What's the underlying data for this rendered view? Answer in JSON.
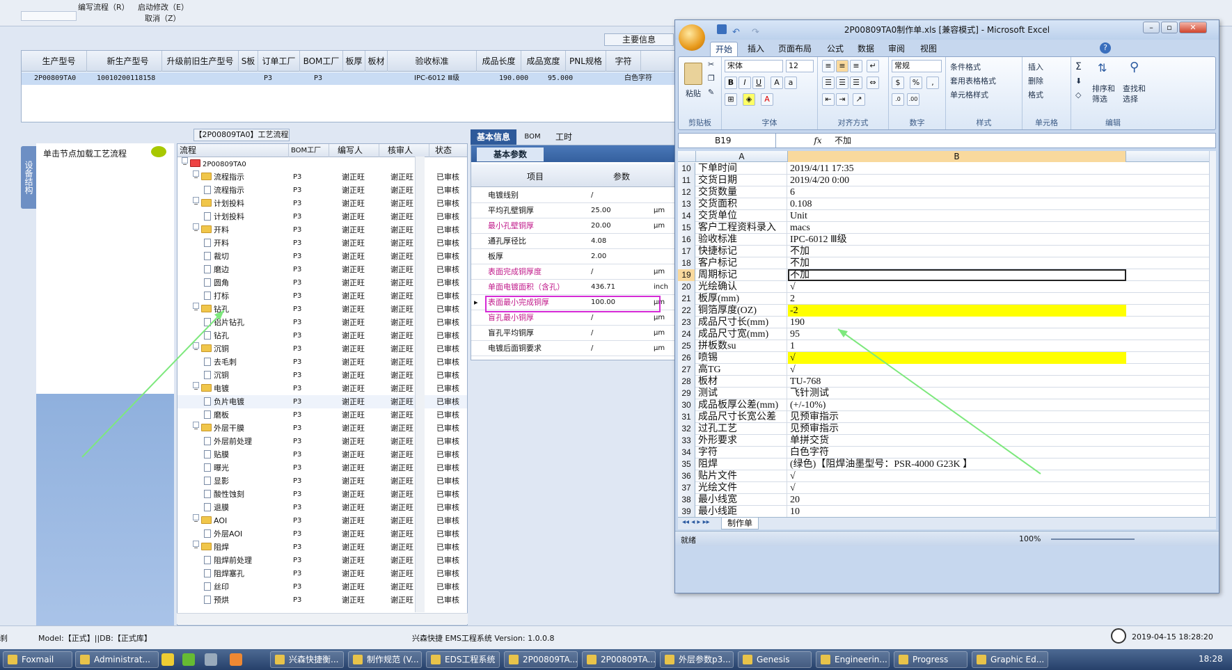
{
  "app": {
    "menu": {
      "edit_flow": "编写流程（R）",
      "start_modify": "启动修改（E）",
      "cancel": "取消（Z）"
    },
    "main_info_label": "主要信息",
    "order_grid": {
      "headers": [
        "生产型号",
        "新生产型号",
        "升级前旧生产型号",
        "S板",
        "订单工厂",
        "BOM工厂",
        "板厚",
        "板材",
        "验收标准",
        "成品长度",
        "成品宽度",
        "PNL规格",
        "字符"
      ],
      "row": {
        "prod": "2P00809TA0",
        "new_prod": "10010200118158",
        "s_board": "P3",
        "order_factory": "P3",
        "standard": "IPC-6012 Ⅲ级",
        "length": "190.000",
        "width": "95.000",
        "char": "白色字符"
      }
    },
    "left": {
      "vtab": "设备结构",
      "load_label": "单击节点加载工艺流程"
    },
    "flow_title": "【2P00809TA0】工艺流程",
    "tree": {
      "headers": [
        "流程",
        "BOM工厂",
        "编写人",
        "核审人",
        "状态"
      ],
      "rows": [
        {
          "label": "2P00809TA0",
          "level": 0,
          "type": "root",
          "bom": "",
          "writer": "",
          "checker": "",
          "status": ""
        },
        {
          "label": "流程指示",
          "level": 1,
          "type": "folder",
          "bom": "P3",
          "writer": "谢正旺",
          "checker": "谢正旺",
          "status": "已审核"
        },
        {
          "label": "流程指示",
          "level": 2,
          "type": "doc",
          "bom": "P3",
          "writer": "谢正旺",
          "checker": "谢正旺",
          "status": "已审核"
        },
        {
          "label": "计划投料",
          "level": 1,
          "type": "folder",
          "bom": "P3",
          "writer": "谢正旺",
          "checker": "谢正旺",
          "status": "已审核"
        },
        {
          "label": "计划投料",
          "level": 2,
          "type": "doc",
          "bom": "P3",
          "writer": "谢正旺",
          "checker": "谢正旺",
          "status": "已审核"
        },
        {
          "label": "开料",
          "level": 1,
          "type": "folder",
          "bom": "P3",
          "writer": "谢正旺",
          "checker": "谢正旺",
          "status": "已审核"
        },
        {
          "label": "开料",
          "level": 2,
          "type": "doc",
          "bom": "P3",
          "writer": "谢正旺",
          "checker": "谢正旺",
          "status": "已审核"
        },
        {
          "label": "裁切",
          "level": 2,
          "type": "doc",
          "bom": "P3",
          "writer": "谢正旺",
          "checker": "谢正旺",
          "status": "已审核"
        },
        {
          "label": "磨边",
          "level": 2,
          "type": "doc",
          "bom": "P3",
          "writer": "谢正旺",
          "checker": "谢正旺",
          "status": "已审核"
        },
        {
          "label": "圆角",
          "level": 2,
          "type": "doc",
          "bom": "P3",
          "writer": "谢正旺",
          "checker": "谢正旺",
          "status": "已审核"
        },
        {
          "label": "打标",
          "level": 2,
          "type": "doc",
          "bom": "P3",
          "writer": "谢正旺",
          "checker": "谢正旺",
          "status": "已审核"
        },
        {
          "label": "钻孔",
          "level": 1,
          "type": "folder",
          "bom": "P3",
          "writer": "谢正旺",
          "checker": "谢正旺",
          "status": "已审核"
        },
        {
          "label": "铝片钻孔",
          "level": 2,
          "type": "doc",
          "bom": "P3",
          "writer": "谢正旺",
          "checker": "谢正旺",
          "status": "已审核"
        },
        {
          "label": "钻孔",
          "level": 2,
          "type": "doc",
          "bom": "P3",
          "writer": "谢正旺",
          "checker": "谢正旺",
          "status": "已审核"
        },
        {
          "label": "沉铜",
          "level": 1,
          "type": "folder",
          "bom": "P3",
          "writer": "谢正旺",
          "checker": "谢正旺",
          "status": "已审核"
        },
        {
          "label": "去毛刺",
          "level": 2,
          "type": "doc",
          "bom": "P3",
          "writer": "谢正旺",
          "checker": "谢正旺",
          "status": "已审核"
        },
        {
          "label": "沉铜",
          "level": 2,
          "type": "doc",
          "bom": "P3",
          "writer": "谢正旺",
          "checker": "谢正旺",
          "status": "已审核"
        },
        {
          "label": "电镀",
          "level": 1,
          "type": "folder",
          "bom": "P3",
          "writer": "谢正旺",
          "checker": "谢正旺",
          "status": "已审核"
        },
        {
          "label": "负片电镀",
          "level": 2,
          "type": "doc",
          "bom": "P3",
          "writer": "谢正旺",
          "checker": "谢正旺",
          "status": "已审核",
          "selected": true
        },
        {
          "label": "磨板",
          "level": 2,
          "type": "doc",
          "bom": "P3",
          "writer": "谢正旺",
          "checker": "谢正旺",
          "status": "已审核"
        },
        {
          "label": "外层干膜",
          "level": 1,
          "type": "folder",
          "bom": "P3",
          "writer": "谢正旺",
          "checker": "谢正旺",
          "status": "已审核"
        },
        {
          "label": "外层前处理",
          "level": 2,
          "type": "doc",
          "bom": "P3",
          "writer": "谢正旺",
          "checker": "谢正旺",
          "status": "已审核"
        },
        {
          "label": "贴膜",
          "level": 2,
          "type": "doc",
          "bom": "P3",
          "writer": "谢正旺",
          "checker": "谢正旺",
          "status": "已审核"
        },
        {
          "label": "曝光",
          "level": 2,
          "type": "doc",
          "bom": "P3",
          "writer": "谢正旺",
          "checker": "谢正旺",
          "status": "已审核"
        },
        {
          "label": "显影",
          "level": 2,
          "type": "doc",
          "bom": "P3",
          "writer": "谢正旺",
          "checker": "谢正旺",
          "status": "已审核"
        },
        {
          "label": "酸性蚀刻",
          "level": 2,
          "type": "doc",
          "bom": "P3",
          "writer": "谢正旺",
          "checker": "谢正旺",
          "status": "已审核"
        },
        {
          "label": "退膜",
          "level": 2,
          "type": "doc",
          "bom": "P3",
          "writer": "谢正旺",
          "checker": "谢正旺",
          "status": "已审核"
        },
        {
          "label": "AOI",
          "level": 1,
          "type": "folder",
          "bom": "P3",
          "writer": "谢正旺",
          "checker": "谢正旺",
          "status": "已审核"
        },
        {
          "label": "外层AOI",
          "level": 2,
          "type": "doc",
          "bom": "P3",
          "writer": "谢正旺",
          "checker": "谢正旺",
          "status": "已审核"
        },
        {
          "label": "阻焊",
          "level": 1,
          "type": "folder",
          "bom": "P3",
          "writer": "谢正旺",
          "checker": "谢正旺",
          "status": "已审核"
        },
        {
          "label": "阻焊前处理",
          "level": 2,
          "type": "doc",
          "bom": "P3",
          "writer": "谢正旺",
          "checker": "谢正旺",
          "status": "已审核"
        },
        {
          "label": "阻焊塞孔",
          "level": 2,
          "type": "doc",
          "bom": "P3",
          "writer": "谢正旺",
          "checker": "谢正旺",
          "status": "已审核"
        },
        {
          "label": "丝印",
          "level": 2,
          "type": "doc",
          "bom": "P3",
          "writer": "谢正旺",
          "checker": "谢正旺",
          "status": "已审核"
        },
        {
          "label": "预烘",
          "level": 2,
          "type": "doc",
          "bom": "P3",
          "writer": "谢正旺",
          "checker": "谢正旺",
          "status": "已审核"
        }
      ]
    },
    "right_tabs": [
      "基本信息",
      "BOM",
      "工时"
    ],
    "basic_params": {
      "title": "基本参数",
      "headers": [
        "项目",
        "参数"
      ],
      "rows": [
        {
          "item": "电镀线别",
          "value": "/",
          "unit": "",
          "pink": false
        },
        {
          "item": "平均孔壁铜厚",
          "value": "25.00",
          "unit": "μm",
          "pink": false
        },
        {
          "item": "最小孔壁铜厚",
          "value": "20.00",
          "unit": "μm",
          "pink": true
        },
        {
          "item": "通孔厚径比",
          "value": "4.08",
          "unit": "",
          "pink": false
        },
        {
          "item": "板厚",
          "value": "2.00",
          "unit": "",
          "pink": false
        },
        {
          "item": "表面完成铜厚度",
          "value": "/",
          "unit": "μm",
          "pink": true
        },
        {
          "item": "单面电镀面积（含孔）",
          "value": "436.71",
          "unit": "inch",
          "pink": true
        },
        {
          "item": "表面最小完成铜厚",
          "value": "100.00",
          "unit": "μm",
          "pink": true,
          "current": true
        },
        {
          "item": "盲孔最小铜厚",
          "value": "/",
          "unit": "μm",
          "pink": true
        },
        {
          "item": "盲孔平均铜厚",
          "value": "/",
          "unit": "μm",
          "pink": false
        },
        {
          "item": "电镀后面铜要求",
          "value": "/",
          "unit": "μm",
          "pink": false
        }
      ]
    },
    "status": {
      "left_label": "刹",
      "model": "Model:【正式】||DB:【正式库】",
      "center": "兴森快捷 EMS工程系统 Version: 1.0.0.8",
      "datetime": "2019-04-15 18:28:20"
    }
  },
  "excel": {
    "title": "2P00809TA0制作单.xls [兼容模式] - Microsoft Excel",
    "tabs": [
      "开始",
      "插入",
      "页面布局",
      "公式",
      "数据",
      "审阅",
      "视图"
    ],
    "ribbon": {
      "paste": "粘贴",
      "clipboard": "剪贴板",
      "font_name": "宋体",
      "font_size": "12",
      "font_group": "字体",
      "align_group": "对齐方式",
      "number_format": "常规",
      "number_group": "数字",
      "cond_format": "条件格式",
      "table_format": "套用表格格式",
      "cell_style": "单元格样式",
      "style_group": "样式",
      "insert": "插入",
      "delete": "删除",
      "format": "格式",
      "cells_group": "单元格",
      "sort_filter": "排序和\n筛选",
      "find_select": "查找和\n选择",
      "edit_group": "编辑"
    },
    "name_box": "B19",
    "formula": "不加",
    "columns": [
      "A",
      "B"
    ],
    "rows": [
      {
        "n": "10",
        "a": "下单时间",
        "b": "2019/4/11 17:35"
      },
      {
        "n": "11",
        "a": "交货日期",
        "b": "2019/4/20 0:00"
      },
      {
        "n": "12",
        "a": "交货数量",
        "b": "6"
      },
      {
        "n": "13",
        "a": "交货面积",
        "b": "0.108"
      },
      {
        "n": "14",
        "a": "交货单位",
        "b": "Unit"
      },
      {
        "n": "15",
        "a": "客户工程资料录入",
        "b": "macs"
      },
      {
        "n": "16",
        "a": "验收标准",
        "b": "IPC-6012 Ⅲ级"
      },
      {
        "n": "17",
        "a": "快捷标记",
        "b": "不加"
      },
      {
        "n": "18",
        "a": "客户标记",
        "b": "不加"
      },
      {
        "n": "19",
        "a": "周期标记",
        "b": "不加",
        "current": true
      },
      {
        "n": "20",
        "a": "光绘确认",
        "b": "√"
      },
      {
        "n": "21",
        "a": "板厚(mm)",
        "b": "2"
      },
      {
        "n": "22",
        "a": "铜箔厚度(OZ)",
        "b": "-2",
        "highlight": true
      },
      {
        "n": "23",
        "a": "成品尺寸长(mm)",
        "b": "190"
      },
      {
        "n": "24",
        "a": "成品尺寸宽(mm)",
        "b": "95"
      },
      {
        "n": "25",
        "a": "拼板数su",
        "b": "1"
      },
      {
        "n": "26",
        "a": "喷锡",
        "b": "√",
        "highlight": true
      },
      {
        "n": "27",
        "a": "高TG",
        "b": "√"
      },
      {
        "n": "28",
        "a": "板材",
        "b": "TU-768"
      },
      {
        "n": "29",
        "a": "测试",
        "b": "飞针测试"
      },
      {
        "n": "30",
        "a": "成品板厚公差(mm)",
        "b": "(+/-10%)"
      },
      {
        "n": "31",
        "a": "成品尺寸长宽公差",
        "b": "见预审指示"
      },
      {
        "n": "32",
        "a": "过孔工艺",
        "b": "见预审指示"
      },
      {
        "n": "33",
        "a": "外形要求",
        "b": "单拼交货"
      },
      {
        "n": "34",
        "a": "字符",
        "b": "白色字符"
      },
      {
        "n": "35",
        "a": "阻焊",
        "b": "(绿色)【阻焊油墨型号：PSR-4000 G23K 】"
      },
      {
        "n": "36",
        "a": "贴片文件",
        "b": "√"
      },
      {
        "n": "37",
        "a": "光绘文件",
        "b": "√"
      },
      {
        "n": "38",
        "a": "最小线宽",
        "b": "20"
      },
      {
        "n": "39",
        "a": "最小线距",
        "b": "10"
      }
    ],
    "sheet_tab": "制作单",
    "status_ready": "就绪",
    "zoom": "100%"
  },
  "taskbar": {
    "items": [
      "Foxmail",
      "Administrat...",
      "",
      "",
      "",
      "",
      "兴森快捷衡...",
      "制作规范 (V...",
      "EDS工程系统",
      "2P00809TA...",
      "2P00809TA...",
      "外层参数p3...",
      "Genesis",
      "Engineerin...",
      "Progress",
      "Graphic Ed..."
    ],
    "time": "18:28"
  },
  "colors": {
    "highlight": "#ffff00",
    "pink_text": "#c0198a",
    "arrow": "#7de87d",
    "selection_box": "#d62ad6"
  }
}
